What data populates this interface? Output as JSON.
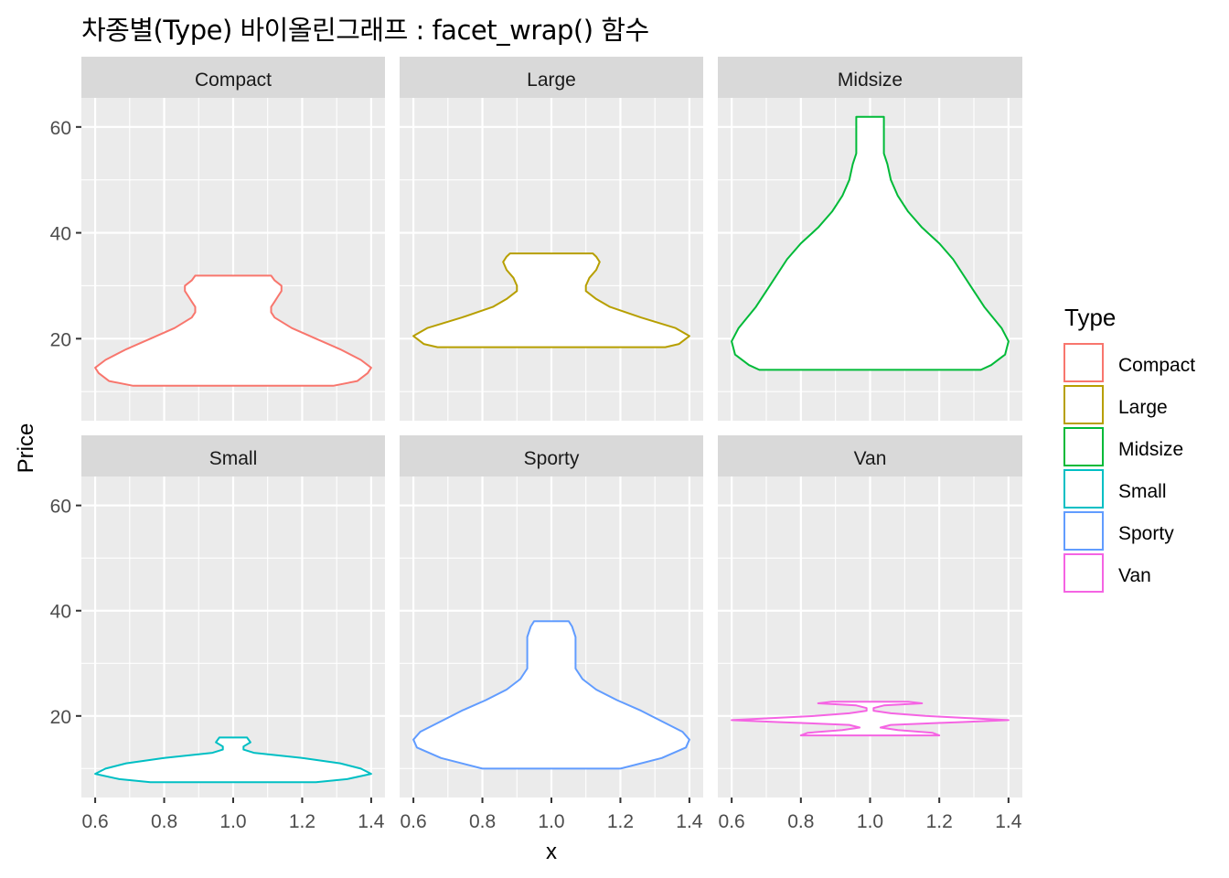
{
  "title": "차종별(Type) 바이올린그래프 : facet_wrap() 함수",
  "chart_data": {
    "type": "violin",
    "title": "차종별(Type) 바이올린그래프 : facet_wrap() 함수",
    "xlabel": "x",
    "ylabel": "Price",
    "xlim": [
      0.56,
      1.44
    ],
    "ylim": [
      4.5,
      65.5
    ],
    "x_ticks": [
      "0.6",
      "0.8",
      "1.0",
      "1.2",
      "1.4"
    ],
    "x_tick_values": [
      0.6,
      0.8,
      1.0,
      1.2,
      1.4
    ],
    "y_ticks": [
      "20",
      "40",
      "60"
    ],
    "y_tick_values": [
      20,
      40,
      60
    ],
    "grid": true,
    "facet": "Type",
    "facet_layout": "2 rows x 3 cols",
    "legend": {
      "title": "Type",
      "position": "right",
      "entries": [
        {
          "label": "Compact",
          "color": "#F8766D"
        },
        {
          "label": "Large",
          "color": "#B79F00"
        },
        {
          "label": "Midsize",
          "color": "#00BA38"
        },
        {
          "label": "Small",
          "color": "#00BFC4"
        },
        {
          "label": "Sporty",
          "color": "#619CFF"
        },
        {
          "label": "Van",
          "color": "#F564E3"
        }
      ]
    },
    "panels": [
      {
        "name": "Compact",
        "color": "#F8766D",
        "y_min": 11.1,
        "y_max": 31.9,
        "profile": [
          [
            11.1,
            0.29
          ],
          [
            12.0,
            0.36
          ],
          [
            13.5,
            0.39
          ],
          [
            14.5,
            0.4
          ],
          [
            16,
            0.37
          ],
          [
            18,
            0.31
          ],
          [
            20,
            0.24
          ],
          [
            22,
            0.17
          ],
          [
            24,
            0.12
          ],
          [
            25,
            0.11
          ],
          [
            26,
            0.11
          ],
          [
            27,
            0.12
          ],
          [
            28,
            0.13
          ],
          [
            29,
            0.14
          ],
          [
            30,
            0.14
          ],
          [
            31,
            0.12
          ],
          [
            31.9,
            0.11
          ]
        ]
      },
      {
        "name": "Large",
        "color": "#B79F00",
        "y_min": 18.4,
        "y_max": 36.1,
        "profile": [
          [
            18.4,
            0.33
          ],
          [
            19.0,
            0.37
          ],
          [
            20.5,
            0.4
          ],
          [
            22,
            0.36
          ],
          [
            24,
            0.26
          ],
          [
            26,
            0.17
          ],
          [
            27.5,
            0.13
          ],
          [
            29,
            0.1
          ],
          [
            30,
            0.1
          ],
          [
            31.5,
            0.11
          ],
          [
            33,
            0.13
          ],
          [
            34.5,
            0.14
          ],
          [
            35.5,
            0.13
          ],
          [
            36.1,
            0.12
          ]
        ]
      },
      {
        "name": "Midsize",
        "color": "#00BA38",
        "y_min": 14.1,
        "y_max": 61.9,
        "profile": [
          [
            14.1,
            0.32
          ],
          [
            15,
            0.35
          ],
          [
            17,
            0.39
          ],
          [
            19.5,
            0.4
          ],
          [
            22,
            0.38
          ],
          [
            26,
            0.33
          ],
          [
            30,
            0.29
          ],
          [
            35,
            0.24
          ],
          [
            38,
            0.2
          ],
          [
            41,
            0.15
          ],
          [
            44,
            0.11
          ],
          [
            47,
            0.08
          ],
          [
            50,
            0.06
          ],
          [
            53,
            0.05
          ],
          [
            55,
            0.04
          ],
          [
            61.9,
            0.04
          ]
        ]
      },
      {
        "name": "Small",
        "color": "#00BFC4",
        "y_min": 7.4,
        "y_max": 15.9,
        "profile": [
          [
            7.4,
            0.24
          ],
          [
            8,
            0.33
          ],
          [
            9,
            0.4
          ],
          [
            10,
            0.37
          ],
          [
            11,
            0.31
          ],
          [
            12,
            0.2
          ],
          [
            13,
            0.06
          ],
          [
            13.6,
            0.03
          ],
          [
            14.2,
            0.03
          ],
          [
            15,
            0.05
          ],
          [
            15.9,
            0.04
          ]
        ]
      },
      {
        "name": "Sporty",
        "color": "#619CFF",
        "y_min": 10.0,
        "y_max": 38.0,
        "profile": [
          [
            10,
            0.2
          ],
          [
            12,
            0.32
          ],
          [
            14,
            0.39
          ],
          [
            15.5,
            0.4
          ],
          [
            17,
            0.38
          ],
          [
            19,
            0.32
          ],
          [
            21,
            0.26
          ],
          [
            23,
            0.19
          ],
          [
            25,
            0.13
          ],
          [
            27,
            0.09
          ],
          [
            29,
            0.07
          ],
          [
            31,
            0.07
          ],
          [
            33,
            0.07
          ],
          [
            35,
            0.07
          ],
          [
            37,
            0.06
          ],
          [
            38,
            0.05
          ]
        ]
      },
      {
        "name": "Van",
        "color": "#F564E3",
        "y_min": 16.3,
        "y_max": 22.7,
        "profile": [
          [
            16.3,
            0.2
          ],
          [
            16.8,
            0.18
          ],
          [
            17.3,
            0.08
          ],
          [
            17.8,
            0.03
          ],
          [
            18.3,
            0.06
          ],
          [
            18.8,
            0.25
          ],
          [
            19.2,
            0.4
          ],
          [
            19.6,
            0.28
          ],
          [
            20.0,
            0.16
          ],
          [
            20.5,
            0.06
          ],
          [
            21.0,
            0.01
          ],
          [
            21.5,
            0.01
          ],
          [
            22.0,
            0.04
          ],
          [
            22.4,
            0.15
          ],
          [
            22.7,
            0.11
          ]
        ]
      }
    ]
  }
}
